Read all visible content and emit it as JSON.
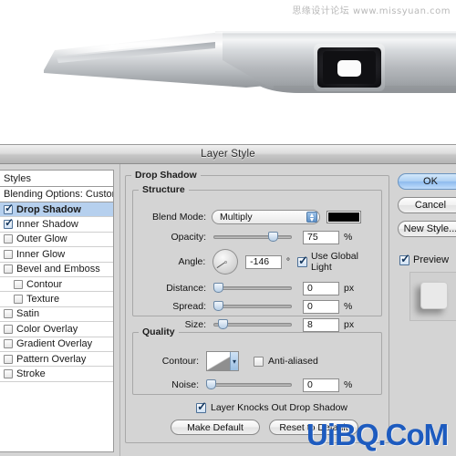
{
  "watermarks": {
    "top": "思缘设计论坛 www.missyuan.com",
    "bottom": "UiBQ.CoM",
    "bottom_color": "#1d5bbf"
  },
  "photo": {
    "alt": "brushed aluminum laptop edge with camera port",
    "metal_light": "#f2f3f4",
    "metal_mid": "#b9bcbf",
    "metal_dark": "#8a8e92",
    "port_dark": "#1b1b1d"
  },
  "dialog": {
    "title": "Layer Style",
    "accent": "#b6d0ee"
  },
  "styles_pane": {
    "header": "Styles",
    "blending": "Blending Options: Custom",
    "items": [
      {
        "label": "Drop Shadow",
        "checked": true,
        "selected": true,
        "indent": false
      },
      {
        "label": "Inner Shadow",
        "checked": true,
        "selected": false,
        "indent": false
      },
      {
        "label": "Outer Glow",
        "checked": false,
        "selected": false,
        "indent": false
      },
      {
        "label": "Inner Glow",
        "checked": false,
        "selected": false,
        "indent": false
      },
      {
        "label": "Bevel and Emboss",
        "checked": false,
        "selected": false,
        "indent": false
      },
      {
        "label": "Contour",
        "checked": false,
        "selected": false,
        "indent": true
      },
      {
        "label": "Texture",
        "checked": false,
        "selected": false,
        "indent": true
      },
      {
        "label": "Satin",
        "checked": false,
        "selected": false,
        "indent": false
      },
      {
        "label": "Color Overlay",
        "checked": false,
        "selected": false,
        "indent": false
      },
      {
        "label": "Gradient Overlay",
        "checked": false,
        "selected": false,
        "indent": false
      },
      {
        "label": "Pattern Overlay",
        "checked": false,
        "selected": false,
        "indent": false
      },
      {
        "label": "Stroke",
        "checked": false,
        "selected": false,
        "indent": false
      }
    ]
  },
  "main": {
    "group_title": "Drop Shadow",
    "structure": {
      "legend": "Structure",
      "blend_mode_label": "Blend Mode:",
      "blend_mode_value": "Multiply",
      "color_swatch": "#000000",
      "opacity_label": "Opacity:",
      "opacity_value": "75",
      "opacity_unit": "%",
      "angle_label": "Angle:",
      "angle_value": "-146",
      "angle_unit": "°",
      "use_global_light": "Use Global Light",
      "use_global_light_checked": true,
      "distance_label": "Distance:",
      "distance_value": "0",
      "distance_unit": "px",
      "spread_label": "Spread:",
      "spread_value": "0",
      "spread_unit": "%",
      "size_label": "Size:",
      "size_value": "8",
      "size_unit": "px"
    },
    "quality": {
      "legend": "Quality",
      "contour_label": "Contour:",
      "anti_aliased_label": "Anti-aliased",
      "anti_aliased_checked": false,
      "noise_label": "Noise:",
      "noise_value": "0",
      "noise_unit": "%"
    },
    "knockout_label": "Layer Knocks Out Drop Shadow",
    "knockout_checked": true,
    "make_default": "Make Default",
    "reset_to_default": "Reset to Default"
  },
  "right": {
    "ok": "OK",
    "cancel": "Cancel",
    "new_style": "New Style...",
    "preview_label": "Preview",
    "preview_checked": true
  }
}
